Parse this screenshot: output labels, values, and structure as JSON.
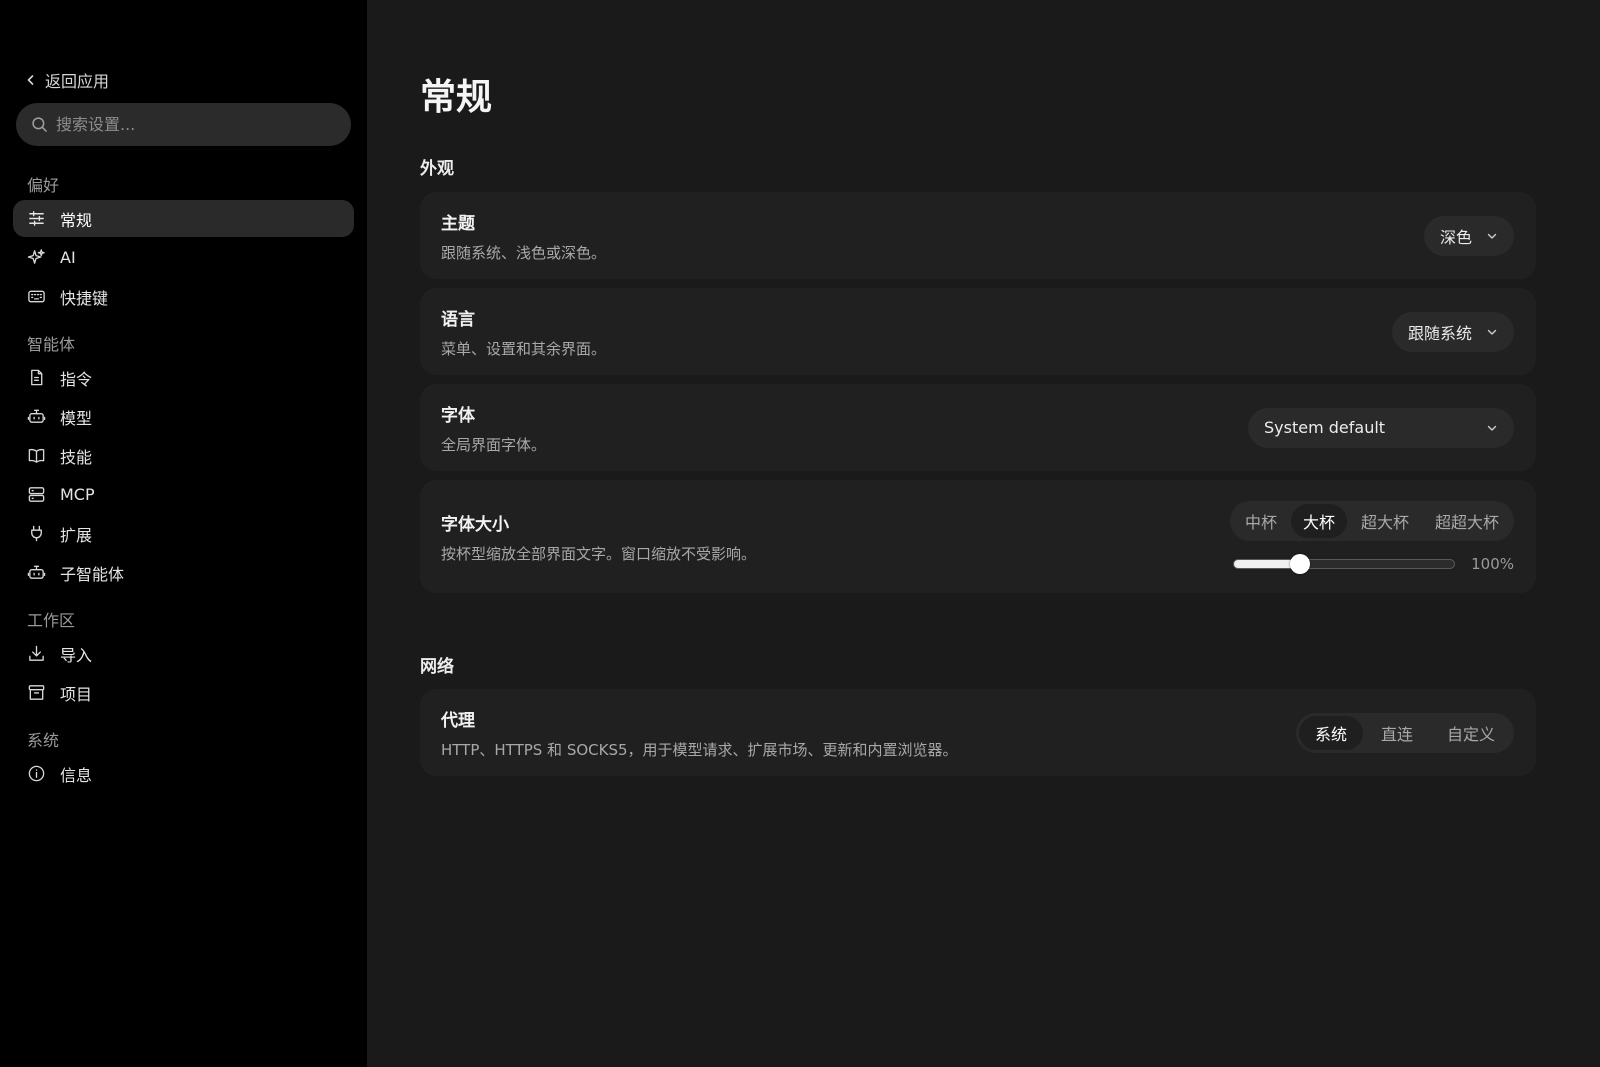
{
  "sidebar": {
    "back_label": "返回应用",
    "search_placeholder": "搜索设置...",
    "sections": [
      {
        "label": "偏好",
        "items": [
          {
            "label": "常规",
            "icon": "sliders-icon",
            "active": true
          },
          {
            "label": "AI",
            "icon": "sparkles-icon"
          },
          {
            "label": "快捷键",
            "icon": "keyboard-icon"
          }
        ]
      },
      {
        "label": "智能体",
        "items": [
          {
            "label": "指令",
            "icon": "document-icon"
          },
          {
            "label": "模型",
            "icon": "robot-icon"
          },
          {
            "label": "技能",
            "icon": "book-icon"
          },
          {
            "label": "MCP",
            "icon": "server-icon"
          },
          {
            "label": "扩展",
            "icon": "plug-icon"
          },
          {
            "label": "子智能体",
            "icon": "robot-icon"
          }
        ]
      },
      {
        "label": "工作区",
        "items": [
          {
            "label": "导入",
            "icon": "download-icon"
          },
          {
            "label": "项目",
            "icon": "archive-icon"
          }
        ]
      },
      {
        "label": "系统",
        "items": [
          {
            "label": "信息",
            "icon": "info-icon"
          }
        ]
      }
    ]
  },
  "main": {
    "title": "常规",
    "appearance": {
      "section_label": "外观",
      "theme": {
        "title": "主题",
        "desc": "跟随系统、浅色或深色。",
        "value": "深色"
      },
      "language": {
        "title": "语言",
        "desc": "菜单、设置和其余界面。",
        "value": "跟随系统"
      },
      "font": {
        "title": "字体",
        "desc": "全局界面字体。",
        "value": "System default"
      },
      "font_size": {
        "title": "字体大小",
        "desc": "按杯型缩放全部界面文字。窗口缩放不受影响。",
        "options": [
          "中杯",
          "大杯",
          "超大杯",
          "超超大杯"
        ],
        "selected": "大杯",
        "slider_fraction": 0.3,
        "value_label": "100%"
      }
    },
    "network": {
      "section_label": "网络",
      "proxy": {
        "title": "代理",
        "desc": "HTTP、HTTPS 和 SOCKS5，用于模型请求、扩展市场、更新和内置浏览器。",
        "options": [
          "系统",
          "直连",
          "自定义"
        ],
        "selected": "系统"
      }
    }
  }
}
